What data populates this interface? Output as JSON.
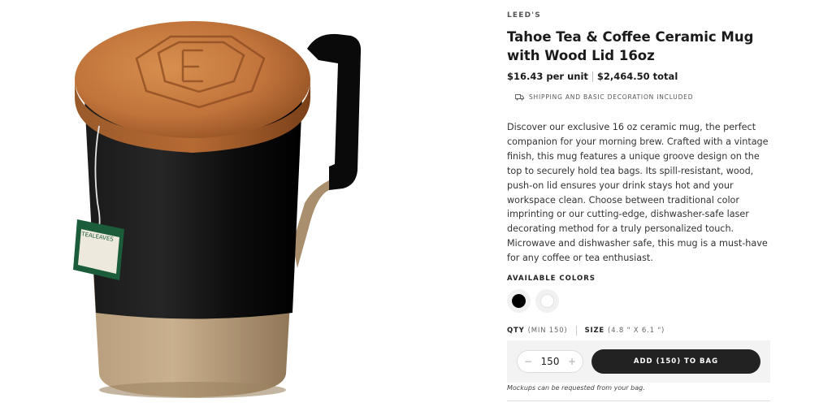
{
  "product": {
    "brand": "LEED'S",
    "title": "Tahoe Tea & Coffee Ceramic Mug with Wood Lid 16oz",
    "price_unit": "$16.43 per unit",
    "price_total": "$2,464.50 total",
    "shipping_note": "SHIPPING AND BASIC DECORATION INCLUDED",
    "description": "Discover our exclusive 16 oz ceramic mug, the perfect companion for your morning brew. Crafted with a vintage finish, this mug features a unique groove design on the top to securely hold tea bags. Its spill-resistant, wood, push-on lid ensures your drink stays hot and your workspace clean. Choose between traditional color imprinting or our cutting-edge, dishwasher-safe laser decorating method for a truly personalized touch. Microwave and dishwasher safe, this mug is a must-have for any coffee or tea enthusiast."
  },
  "colors": {
    "label": "AVAILABLE COLORS",
    "options": [
      {
        "name": "black",
        "hex": "#000000",
        "selected": true
      },
      {
        "name": "white",
        "hex": "#ffffff",
        "selected": false
      }
    ]
  },
  "options": {
    "qty_label": "QTY",
    "qty_min": "(MIN 150)",
    "size_label": "SIZE",
    "size_value": "(4.8 \" X 6.1 \")"
  },
  "cart": {
    "quantity": "150",
    "minus": "−",
    "plus": "+",
    "add_button": "ADD (150) TO BAG",
    "mockup_note": "Mockups can be requested from your bag."
  },
  "image": {
    "tea_tag_brand": "TEALEAVES"
  }
}
